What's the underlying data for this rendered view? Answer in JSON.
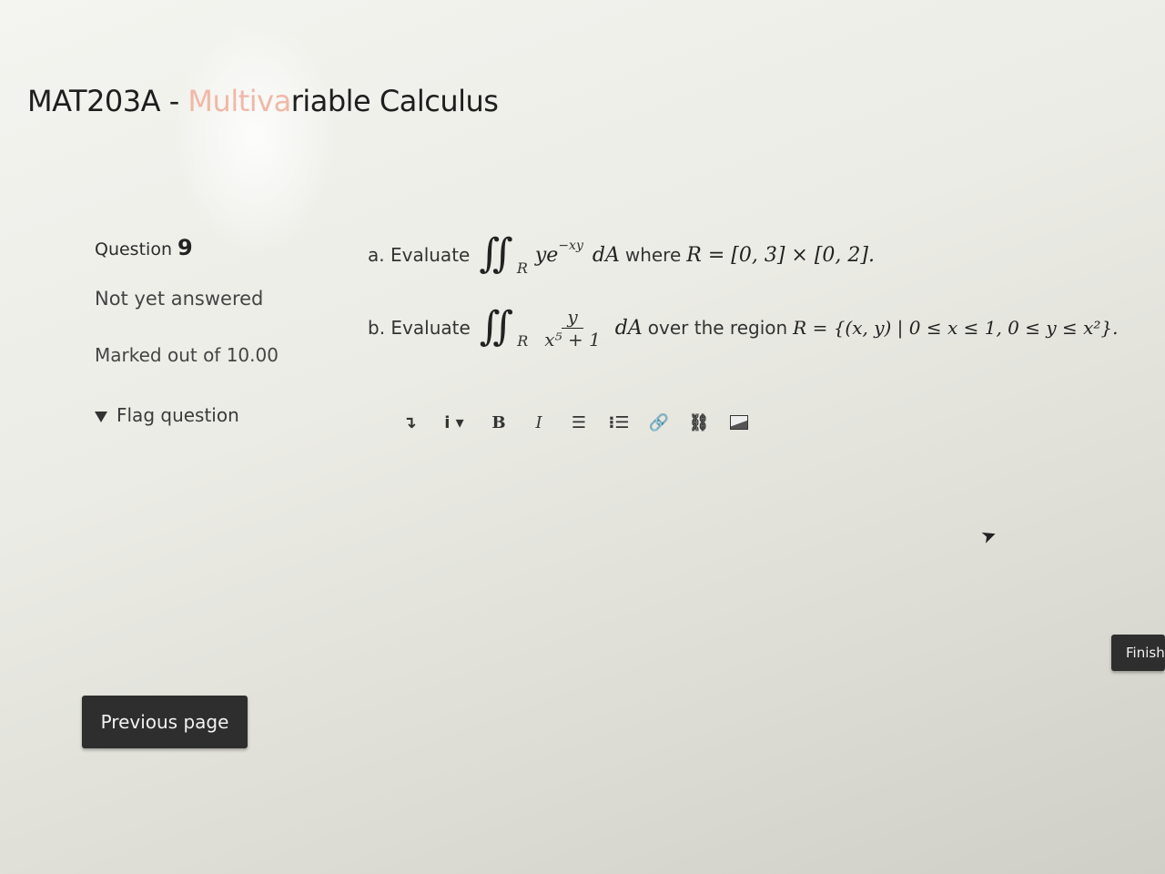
{
  "header": {
    "course_code": "MAT203A - ",
    "course_name_faded": "Multiva",
    "course_name_rest": "riable Calculus"
  },
  "question_info": {
    "label": "Question ",
    "number": "9",
    "state": "Not yet answered",
    "grade": "Marked out of 10.00",
    "flag_label": "Flag question"
  },
  "question": {
    "part_a": {
      "prefix": "a. Evaluate",
      "integral": "∬",
      "region_sub": "R",
      "integrand_base": "ye",
      "integrand_exp": "−xy",
      "differential": "dA",
      "connector": "where",
      "region_def": "R = [0, 3] × [0, 2]."
    },
    "part_b": {
      "prefix": "b. Evaluate",
      "integral": "∬",
      "region_sub": "R",
      "numerator": "y",
      "denominator": "x⁵ + 1",
      "differential": "dA",
      "connector": "over the region",
      "region_def": "R = {(x, y) | 0 ≤ x ≤ 1, 0 ≤ y ≤ x²}."
    }
  },
  "toolbar": {
    "items": [
      {
        "name": "expand-toolbar",
        "glyph": "↴"
      },
      {
        "name": "paragraph-styles",
        "glyph": "i ▾"
      },
      {
        "name": "bold",
        "glyph": "B"
      },
      {
        "name": "italic",
        "glyph": "I"
      },
      {
        "name": "unordered-list",
        "glyph": "☰"
      },
      {
        "name": "ordered-list",
        "glyph": "⁝☰"
      },
      {
        "name": "link",
        "glyph": "🔗"
      },
      {
        "name": "unlink",
        "glyph": "⛓"
      },
      {
        "name": "image",
        "glyph": ""
      }
    ]
  },
  "navigation": {
    "previous_label": "Previous page",
    "finish_label": "Finish"
  }
}
